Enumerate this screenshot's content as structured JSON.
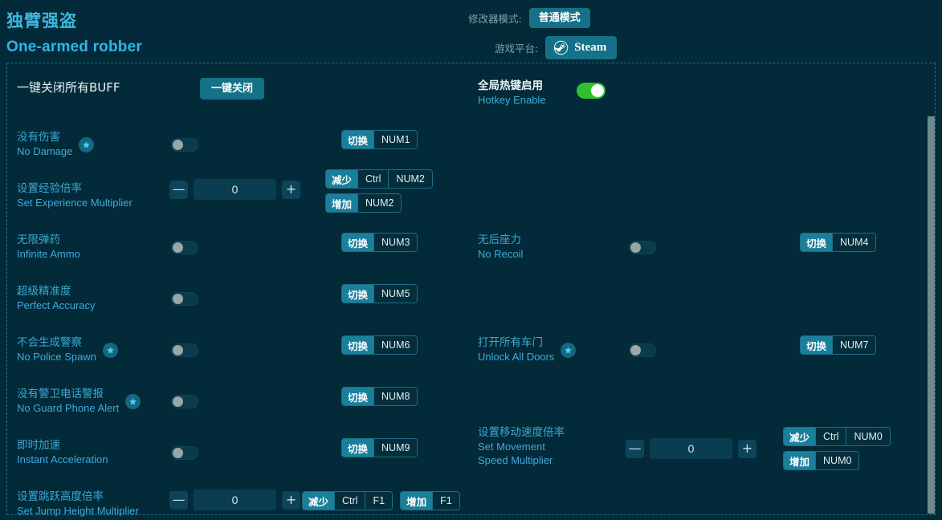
{
  "header": {
    "title_zh": "独臂强盗",
    "title_en": "One-armed robber",
    "mode_label": "修改器模式:",
    "mode_value": "普通模式",
    "platform_label": "游戏平台:",
    "platform_value": "Steam",
    "platform_icon": "steam-icon"
  },
  "global": {
    "close_all_zh": "一键关闭所有BUFF",
    "close_all_button": "一键关闭",
    "hotkey_zh": "全局热键启用",
    "hotkey_en": "Hotkey Enable",
    "hotkey_state": "on"
  },
  "colors": {
    "background": "#032a38",
    "accent": "#1a7f9b",
    "label_cyan": "#39a9d6",
    "toggle_on": "#2fc22f",
    "toggle_off": "#0b3b4b",
    "scrollbar": "#6d8b8e",
    "border_dashed": "#1f6f86"
  },
  "cheats": [
    {
      "zh": "没有伤害",
      "en": "No Damage",
      "star": true,
      "control": "toggle",
      "value": "off",
      "hotkeys": [
        {
          "action": "切换",
          "keys": [
            "NUM1"
          ]
        }
      ]
    },
    {
      "zh": "设置经验倍率",
      "en": "Set Experience Multiplier",
      "star": false,
      "control": "stepper",
      "value": "0",
      "minus": "—",
      "plus": "+",
      "hotkeys": [
        {
          "action": "减少",
          "keys": [
            "Ctrl",
            "NUM2"
          ]
        },
        {
          "action": "增加",
          "keys": [
            "NUM2"
          ]
        }
      ]
    },
    {
      "zh": "无限弹药",
      "en": "Infinite Ammo",
      "star": false,
      "control": "toggle",
      "value": "off",
      "hotkeys": [
        {
          "action": "切换",
          "keys": [
            "NUM3"
          ]
        }
      ]
    },
    {
      "zh": "无后座力",
      "en": "No Recoil",
      "star": false,
      "control": "toggle",
      "value": "off",
      "hotkeys": [
        {
          "action": "切换",
          "keys": [
            "NUM4"
          ]
        }
      ]
    },
    {
      "zh": "超级精准度",
      "en": "Perfect Accuracy",
      "star": false,
      "control": "toggle",
      "value": "off",
      "hotkeys": [
        {
          "action": "切换",
          "keys": [
            "NUM5"
          ]
        }
      ]
    },
    {
      "zh": "不会生成警察",
      "en": "No Police Spawn",
      "star": true,
      "control": "toggle",
      "value": "off",
      "hotkeys": [
        {
          "action": "切换",
          "keys": [
            "NUM6"
          ]
        }
      ]
    },
    {
      "zh": "打开所有车门",
      "en": "Unlock All Doors",
      "star": true,
      "control": "toggle",
      "value": "off",
      "hotkeys": [
        {
          "action": "切换",
          "keys": [
            "NUM7"
          ]
        }
      ]
    },
    {
      "zh": "没有警卫电话警报",
      "en": "No Guard Phone Alert",
      "star": true,
      "control": "toggle",
      "value": "off",
      "hotkeys": [
        {
          "action": "切换",
          "keys": [
            "NUM8"
          ]
        }
      ]
    },
    {
      "zh": "即时加速",
      "en": "Instant Acceleration",
      "star": false,
      "control": "toggle",
      "value": "off",
      "hotkeys": [
        {
          "action": "切换",
          "keys": [
            "NUM9"
          ]
        }
      ]
    },
    {
      "zh": "设置移动速度倍率",
      "en": "Set Movement Speed Multiplier",
      "star": false,
      "control": "stepper",
      "value": "0",
      "minus": "—",
      "plus": "+",
      "hotkeys": [
        {
          "action": "减少",
          "keys": [
            "Ctrl",
            "NUM0"
          ]
        },
        {
          "action": "增加",
          "keys": [
            "NUM0"
          ]
        }
      ]
    },
    {
      "zh": "设置跳跃高度倍率",
      "en": "Set Jump Height Multiplier",
      "star": false,
      "control": "stepper",
      "value": "0",
      "minus": "—",
      "plus": "+",
      "hotkeys": [
        {
          "action": "减少",
          "keys": [
            "Ctrl",
            "F1"
          ]
        },
        {
          "action": "增加",
          "keys": [
            "F1"
          ]
        }
      ]
    }
  ]
}
